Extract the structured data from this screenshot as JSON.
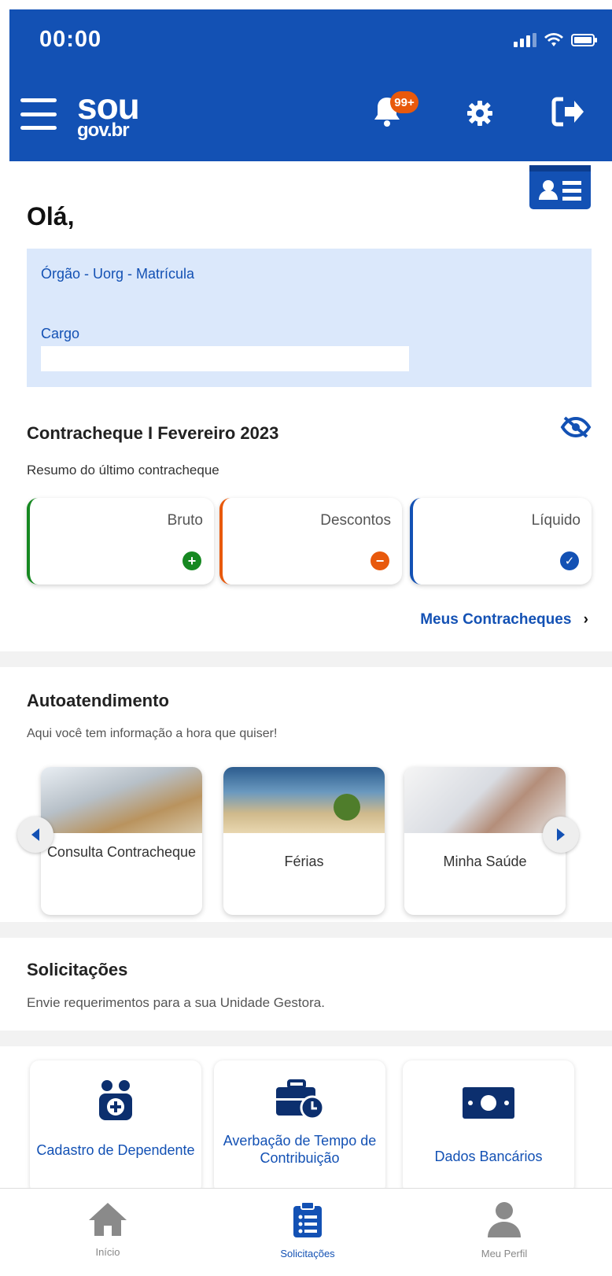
{
  "status_bar": {
    "time": "00:00"
  },
  "header": {
    "logo_top": "sou",
    "logo_bottom": "gov.br",
    "notification_badge": "99+",
    "brand_color": "#1351b4"
  },
  "greeting": {
    "text": "Olá,"
  },
  "info": {
    "line1": "Órgão - Uorg - Matrícula",
    "line2": "Cargo"
  },
  "contracheque": {
    "title": "Contracheque I Fevereiro 2023",
    "subtitle": "Resumo do último contracheque",
    "cards": [
      {
        "label": "Bruto",
        "color": "#168821",
        "icon": "plus-circle-icon"
      },
      {
        "label": "Descontos",
        "color": "#e8590c",
        "icon": "minus-circle-icon"
      },
      {
        "label": "Líquido",
        "color": "#1351b4",
        "icon": "check-circle-icon"
      }
    ],
    "link": "Meus Contracheques"
  },
  "autoatendimento": {
    "title": "Autoatendimento",
    "subtitle": "Aqui você tem informação a hora que quiser!",
    "items": [
      {
        "label": "Consulta Contracheque"
      },
      {
        "label": "Férias"
      },
      {
        "label": "Minha Saúde"
      }
    ]
  },
  "solicitacoes": {
    "title": "Solicitações",
    "subtitle": "Envie requerimentos para a sua Unidade Gestora.",
    "items": [
      {
        "label": "Cadastro de Dependente"
      },
      {
        "label": "Averbação de Tempo de Contribuição"
      },
      {
        "label": "Dados Bancários"
      }
    ]
  },
  "bottom_nav": [
    {
      "label": "Início",
      "icon": "home-icon"
    },
    {
      "label": "Solicitações",
      "icon": "clipboard-list-icon"
    },
    {
      "label": "Meu Perfil",
      "icon": "user-icon"
    }
  ]
}
